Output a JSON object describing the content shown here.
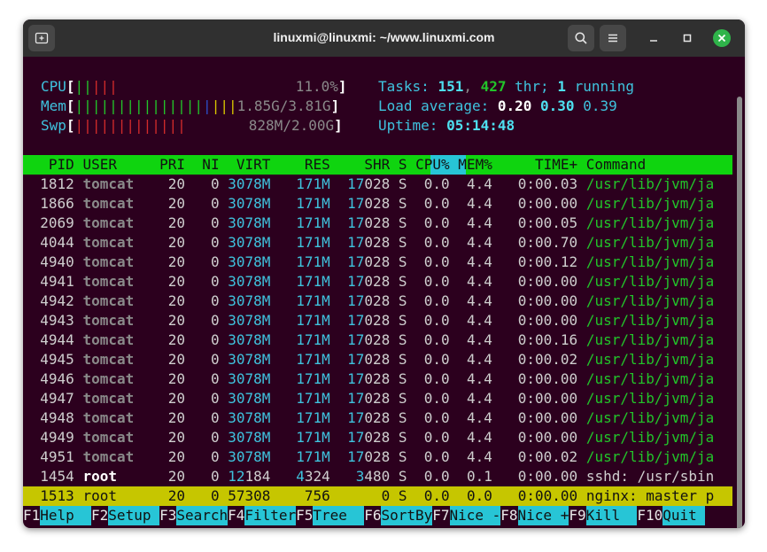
{
  "window": {
    "title": "linuxmi@linuxmi: ~/www.linuxmi.com"
  },
  "meters": {
    "cpu": {
      "label": "CPU",
      "bars": "||",
      "bars_red": "|||",
      "value": "11.0%"
    },
    "mem": {
      "label": "Mem",
      "bars": "|||||||||||||||",
      "bars_blue": "|",
      "bars_yellow": "|||",
      "value": "1.85G/3.81G"
    },
    "swp": {
      "label": "Swp",
      "bars": "|||||||||||||",
      "value": "828M/2.00G"
    }
  },
  "summary": {
    "tasks_label": "Tasks: ",
    "tasks": "151",
    "sep": ", ",
    "threads": "427",
    "thr_label": " thr; ",
    "running": "1",
    "running_label": " running",
    "load_label": "Load average: ",
    "load1": "0.20",
    "load5": "0.30",
    "load15": "0.39",
    "uptime_label": "Uptime: ",
    "uptime": "05:14:48"
  },
  "columns": [
    "PID",
    "USER",
    "PRI",
    "NI",
    "VIRT",
    "RES",
    "SHR",
    "S",
    "CPU%",
    "MEM%",
    "TIME+",
    "Command"
  ],
  "processes": [
    {
      "pid": "1812",
      "user": "tomcat",
      "pri": "20",
      "ni": "0",
      "virt": "3078M",
      "res": "171M",
      "shr_a": "17",
      "shr_b": "028",
      "s": "S",
      "cpu": "0.0",
      "mem": "4.4",
      "time": "0:00.03",
      "cmd": "/usr/lib/jvm/ja"
    },
    {
      "pid": "1866",
      "user": "tomcat",
      "pri": "20",
      "ni": "0",
      "virt": "3078M",
      "res": "171M",
      "shr_a": "17",
      "shr_b": "028",
      "s": "S",
      "cpu": "0.0",
      "mem": "4.4",
      "time": "0:00.00",
      "cmd": "/usr/lib/jvm/ja"
    },
    {
      "pid": "2069",
      "user": "tomcat",
      "pri": "20",
      "ni": "0",
      "virt": "3078M",
      "res": "171M",
      "shr_a": "17",
      "shr_b": "028",
      "s": "S",
      "cpu": "0.0",
      "mem": "4.4",
      "time": "0:00.05",
      "cmd": "/usr/lib/jvm/ja"
    },
    {
      "pid": "4044",
      "user": "tomcat",
      "pri": "20",
      "ni": "0",
      "virt": "3078M",
      "res": "171M",
      "shr_a": "17",
      "shr_b": "028",
      "s": "S",
      "cpu": "0.0",
      "mem": "4.4",
      "time": "0:00.70",
      "cmd": "/usr/lib/jvm/ja"
    },
    {
      "pid": "4940",
      "user": "tomcat",
      "pri": "20",
      "ni": "0",
      "virt": "3078M",
      "res": "171M",
      "shr_a": "17",
      "shr_b": "028",
      "s": "S",
      "cpu": "0.0",
      "mem": "4.4",
      "time": "0:00.12",
      "cmd": "/usr/lib/jvm/ja"
    },
    {
      "pid": "4941",
      "user": "tomcat",
      "pri": "20",
      "ni": "0",
      "virt": "3078M",
      "res": "171M",
      "shr_a": "17",
      "shr_b": "028",
      "s": "S",
      "cpu": "0.0",
      "mem": "4.4",
      "time": "0:00.00",
      "cmd": "/usr/lib/jvm/ja"
    },
    {
      "pid": "4942",
      "user": "tomcat",
      "pri": "20",
      "ni": "0",
      "virt": "3078M",
      "res": "171M",
      "shr_a": "17",
      "shr_b": "028",
      "s": "S",
      "cpu": "0.0",
      "mem": "4.4",
      "time": "0:00.00",
      "cmd": "/usr/lib/jvm/ja"
    },
    {
      "pid": "4943",
      "user": "tomcat",
      "pri": "20",
      "ni": "0",
      "virt": "3078M",
      "res": "171M",
      "shr_a": "17",
      "shr_b": "028",
      "s": "S",
      "cpu": "0.0",
      "mem": "4.4",
      "time": "0:00.00",
      "cmd": "/usr/lib/jvm/ja"
    },
    {
      "pid": "4944",
      "user": "tomcat",
      "pri": "20",
      "ni": "0",
      "virt": "3078M",
      "res": "171M",
      "shr_a": "17",
      "shr_b": "028",
      "s": "S",
      "cpu": "0.0",
      "mem": "4.4",
      "time": "0:00.16",
      "cmd": "/usr/lib/jvm/ja"
    },
    {
      "pid": "4945",
      "user": "tomcat",
      "pri": "20",
      "ni": "0",
      "virt": "3078M",
      "res": "171M",
      "shr_a": "17",
      "shr_b": "028",
      "s": "S",
      "cpu": "0.0",
      "mem": "4.4",
      "time": "0:00.02",
      "cmd": "/usr/lib/jvm/ja"
    },
    {
      "pid": "4946",
      "user": "tomcat",
      "pri": "20",
      "ni": "0",
      "virt": "3078M",
      "res": "171M",
      "shr_a": "17",
      "shr_b": "028",
      "s": "S",
      "cpu": "0.0",
      "mem": "4.4",
      "time": "0:00.00",
      "cmd": "/usr/lib/jvm/ja"
    },
    {
      "pid": "4947",
      "user": "tomcat",
      "pri": "20",
      "ni": "0",
      "virt": "3078M",
      "res": "171M",
      "shr_a": "17",
      "shr_b": "028",
      "s": "S",
      "cpu": "0.0",
      "mem": "4.4",
      "time": "0:00.00",
      "cmd": "/usr/lib/jvm/ja"
    },
    {
      "pid": "4948",
      "user": "tomcat",
      "pri": "20",
      "ni": "0",
      "virt": "3078M",
      "res": "171M",
      "shr_a": "17",
      "shr_b": "028",
      "s": "S",
      "cpu": "0.0",
      "mem": "4.4",
      "time": "0:00.00",
      "cmd": "/usr/lib/jvm/ja"
    },
    {
      "pid": "4949",
      "user": "tomcat",
      "pri": "20",
      "ni": "0",
      "virt": "3078M",
      "res": "171M",
      "shr_a": "17",
      "shr_b": "028",
      "s": "S",
      "cpu": "0.0",
      "mem": "4.4",
      "time": "0:00.00",
      "cmd": "/usr/lib/jvm/ja"
    },
    {
      "pid": "4951",
      "user": "tomcat",
      "pri": "20",
      "ni": "0",
      "virt": "3078M",
      "res": "171M",
      "shr_a": "17",
      "shr_b": "028",
      "s": "S",
      "cpu": "0.0",
      "mem": "4.4",
      "time": "0:00.02",
      "cmd": "/usr/lib/jvm/ja"
    },
    {
      "pid": "1454",
      "user": "root",
      "pri": "20",
      "ni": "0",
      "virt_a": "12",
      "virt_b": "184",
      "res_a": "4",
      "res_b": "324",
      "shr_a": "3",
      "shr_b": "480",
      "s": "S",
      "cpu": "0.0",
      "mem": "0.1",
      "time": "0:00.00",
      "cmd": "sshd: /usr/sbin"
    }
  ],
  "selected": {
    "pid": "1513",
    "user": "root",
    "pri": "20",
    "ni": "0",
    "virt": "57308",
    "res": "756",
    "shr": "0",
    "s": "S",
    "cpu": "0.0",
    "mem": "0.0",
    "time": "0:00.00",
    "cmd": "nginx: master p"
  },
  "function_keys": [
    {
      "key": "F1",
      "label": "Help  "
    },
    {
      "key": "F2",
      "label": "Setup "
    },
    {
      "key": "F3",
      "label": "Search"
    },
    {
      "key": "F4",
      "label": "Filter"
    },
    {
      "key": "F5",
      "label": "Tree  "
    },
    {
      "key": "F6",
      "label": "SortBy"
    },
    {
      "key": "F7",
      "label": "Nice -"
    },
    {
      "key": "F8",
      "label": "Nice +"
    },
    {
      "key": "F9",
      "label": "Kill  "
    },
    {
      "key": "F10",
      "label": "Quit "
    }
  ],
  "icons": {
    "new_tab": "new-tab-icon",
    "search": "search-icon",
    "menu": "hamburger-menu-icon",
    "minimize": "minimize-icon",
    "maximize": "maximize-icon",
    "close": "close-icon"
  },
  "colors": {
    "terminal_bg": "#2c001e",
    "header_bar": "#0fd40f",
    "selected_row": "#c6c600",
    "fkey_label_bg": "#27c5d6",
    "close_button": "#2fb44a"
  }
}
